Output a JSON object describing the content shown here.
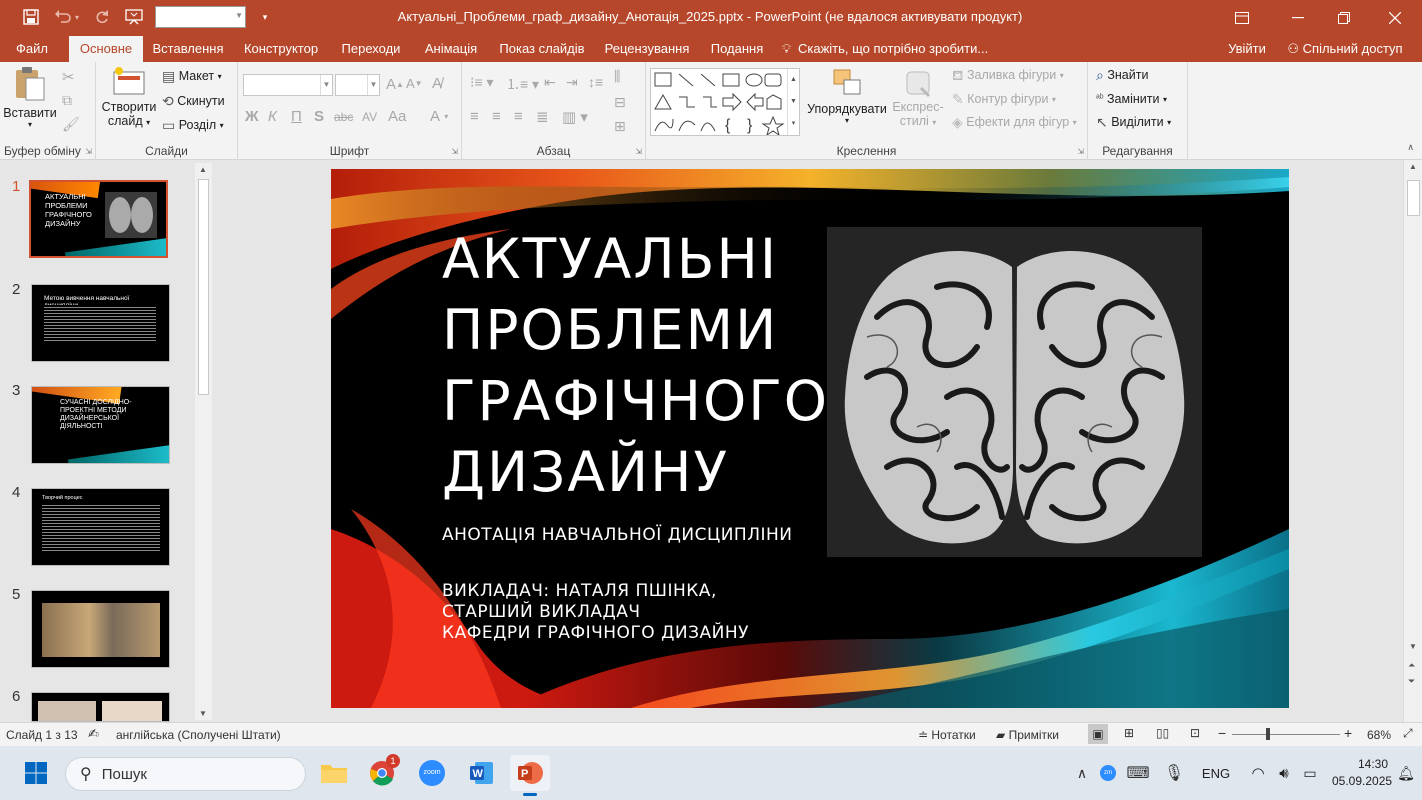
{
  "titlebar": {
    "title": "Актуальні_Проблеми_граф_дизайну_Анотація_2025.pptx - PowerPoint (не вдалося активувати продукт)",
    "icons": [
      "save-icon",
      "undo-icon",
      "redo-icon",
      "presenter-icon",
      "customize-icon"
    ]
  },
  "tabs": [
    {
      "label": "Файл"
    },
    {
      "label": "Основне"
    },
    {
      "label": "Вставлення"
    },
    {
      "label": "Конструктор"
    },
    {
      "label": "Переходи"
    },
    {
      "label": "Анімація"
    },
    {
      "label": "Показ слайдів"
    },
    {
      "label": "Рецензування"
    },
    {
      "label": "Подання"
    }
  ],
  "tellme": "Скажіть, що потрібно зробити...",
  "signin": "Увійти",
  "share": "Спільний доступ",
  "ribbon": {
    "clipboard": {
      "label": "Буфер обміну",
      "paste": "Вставити"
    },
    "slides": {
      "label": "Слайди",
      "new_slide_1": "Створити",
      "new_slide_2": "слайд",
      "layout": "Макет",
      "reset": "Скинути",
      "section": "Розділ"
    },
    "font": {
      "label": "Шрифт",
      "bold": "Ж",
      "italic": "К",
      "underline": "П",
      "shadow": "S",
      "strike": "abc",
      "spacing": "AV",
      "case": "Aa",
      "grow": "A",
      "shrink": "A",
      "color": "A"
    },
    "paragraph": {
      "label": "Абзац"
    },
    "drawing": {
      "label": "Креслення",
      "arrange": "Упорядкувати",
      "quick_1": "Експрес-",
      "quick_2": "стилі",
      "fill": "Заливка фігури",
      "outline": "Контур фігури",
      "effects": "Ефекти для фігур"
    },
    "editing": {
      "label": "Редагування",
      "find": "Знайти",
      "replace": "Замінити",
      "select": "Виділити"
    }
  },
  "thumbnails": [
    {
      "num": "1",
      "title": "АКТУАЛЬНІ ПРОБЛЕМИ ГРАФІЧНОГО ДИЗАЙНУ"
    },
    {
      "num": "2",
      "title": "Метою вивчення навчальної дисципліни"
    },
    {
      "num": "3",
      "title": "СУЧАСНІ ДОСЛІДНО-ПРОЕКТНІ МЕТОДИ ДИЗАЙНЕРСЬКОЇ ДІЯЛЬНОСТІ"
    },
    {
      "num": "4",
      "title": "Творчий процес"
    },
    {
      "num": "5",
      "title": ""
    },
    {
      "num": "6",
      "title": ""
    }
  ],
  "slide": {
    "title_lines": [
      "АКТУАЛЬНІ",
      "ПРОБЛЕМИ",
      "ГРАФІЧНОГО",
      "ДИЗАЙНУ"
    ],
    "subtitle": "АНОТАЦІЯ НАВЧАЛЬНОЇ ДИСЦИПЛІНИ",
    "lecturer_lines": [
      "ВИКЛАДАЧ: НАТАЛЯ ПШІНКА,",
      "СТАРШИЙ ВИКЛАДАЧ",
      "КАФЕДРИ ГРАФІЧНОГО ДИЗАЙНУ"
    ]
  },
  "status": {
    "slide_info": "Слайд 1 з 13",
    "language": "англійська (Сполучені Штати)",
    "notes": "Нотатки",
    "comments": "Примітки",
    "zoom": "68%",
    "zoom_level": 0.68
  },
  "taskbar": {
    "search": "Пошук",
    "lang": "ENG",
    "time": "14:30",
    "date": "05.09.2025",
    "chrome_badge": "1"
  },
  "colors": {
    "accent": "#b7472a",
    "selected": "#d35230",
    "slide_bg": "#000000"
  }
}
